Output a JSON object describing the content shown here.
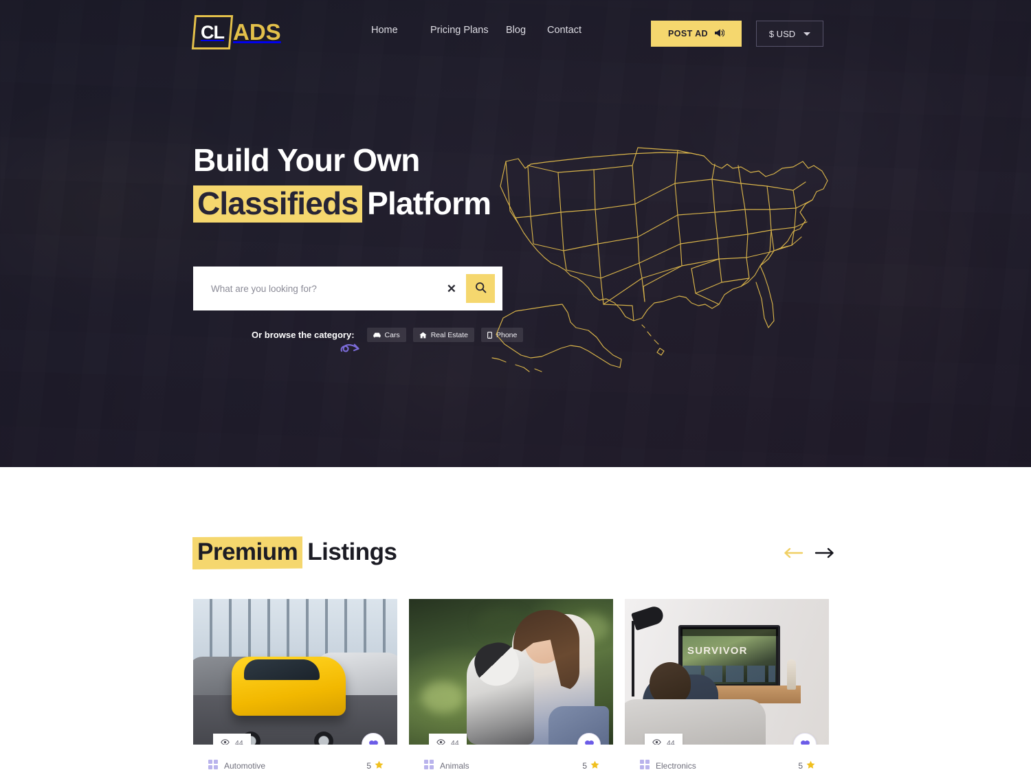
{
  "header": {
    "logo": {
      "mark": "CL",
      "word": "ADS"
    },
    "nav": [
      {
        "label": "Home"
      },
      {
        "label": "Pricing Plans"
      },
      {
        "label": "Blog"
      },
      {
        "label": "Contact"
      }
    ],
    "post_ad_label": "POST AD",
    "post_ad_icon": "megaphone-icon",
    "currency": {
      "value": "$ USD",
      "icon": "chevron-down-icon"
    }
  },
  "hero": {
    "heading_line1": "Build Your Own",
    "heading_highlight": "Classifieds",
    "heading_rest": "Platform",
    "search": {
      "placeholder": "What are you looking for?",
      "value": "",
      "clear_icon": "close-icon",
      "submit_icon": "search-icon"
    },
    "browse_label": "Or browse the category:",
    "categories": [
      {
        "label": "Cars",
        "icon": "car-icon"
      },
      {
        "label": "Real Estate",
        "icon": "home-icon"
      },
      {
        "label": "Phone",
        "icon": "phone-icon"
      }
    ],
    "map_alt": "united-states-map",
    "decoration": "purple-swirl-arrow"
  },
  "listings": {
    "title_highlight": "Premium",
    "title_rest": "Listings",
    "prev_icon": "arrow-left-icon",
    "next_icon": "arrow-right-icon",
    "cards": [
      {
        "image_alt": "yellow-suv-in-showroom",
        "views": "44",
        "views_icon": "eye-icon",
        "favorite_icon": "heart-icon",
        "category": "Automotive",
        "category_icon": "category-icon",
        "rating": "5",
        "rating_icon": "star-icon"
      },
      {
        "image_alt": "woman-hugging-husky-dog",
        "views": "44",
        "views_icon": "eye-icon",
        "favorite_icon": "heart-icon",
        "category": "Animals",
        "category_icon": "category-icon",
        "rating": "5",
        "rating_icon": "star-icon"
      },
      {
        "image_alt": "man-watching-survivor-on-tv",
        "views": "44",
        "views_icon": "eye-icon",
        "favorite_icon": "heart-icon",
        "category": "Electronics",
        "category_icon": "category-icon",
        "rating": "5",
        "rating_icon": "star-icon"
      }
    ]
  },
  "colors": {
    "accent_yellow": "#f5d76e",
    "logo_gold": "#e3c04a",
    "hero_dark": "#201f2e",
    "heart_purple": "#6c5ce7",
    "text_dark": "#1c1c24"
  }
}
